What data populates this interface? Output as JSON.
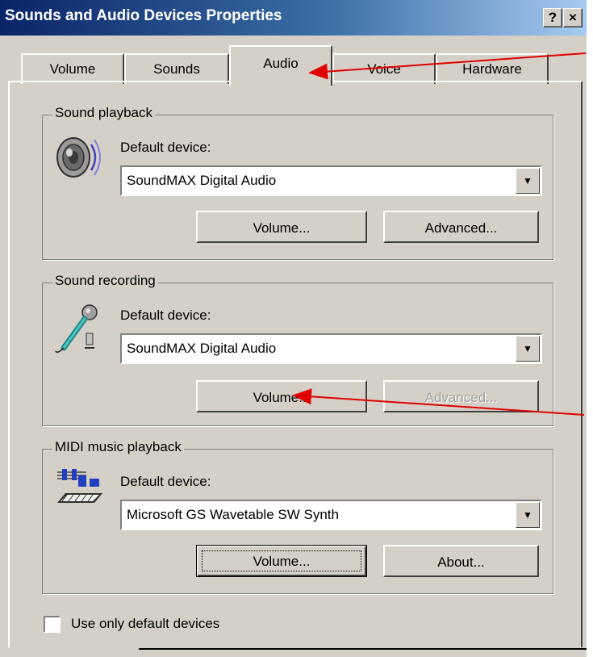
{
  "window": {
    "title": "Sounds and Audio Devices Properties",
    "help_btn": "?",
    "close_btn": "×"
  },
  "tabs": [
    {
      "label": "Volume",
      "selected": false
    },
    {
      "label": "Sounds",
      "selected": false
    },
    {
      "label": "Audio",
      "selected": true
    },
    {
      "label": "Voice",
      "selected": false
    },
    {
      "label": "Hardware",
      "selected": false
    }
  ],
  "playback": {
    "group_label": "Sound playback",
    "default_label": "Default device:",
    "device": "SoundMAX Digital Audio",
    "volume_label": "Volume...",
    "advanced_label": "Advanced..."
  },
  "recording": {
    "group_label": "Sound recording",
    "default_label": "Default device:",
    "device": "SoundMAX Digital Audio",
    "volume_label": "Volume...",
    "advanced_label": "Advanced...",
    "advanced_enabled": false
  },
  "midi": {
    "group_label": "MIDI music playback",
    "default_label": "Default device:",
    "device": "Microsoft GS Wavetable SW Synth",
    "volume_label": "Volume...",
    "about_label": "About..."
  },
  "checkbox": {
    "label": "Use only default devices",
    "checked": false
  },
  "colors": {
    "dialog_face": "#d4d0c8",
    "title_start": "#0a246a",
    "title_end": "#a6caf0",
    "annotation_arrow": "#e00000"
  },
  "icons": {
    "playback": "speaker-icon",
    "recording": "microphone-icon",
    "midi": "midi-keyboard-icon",
    "combo": "dropdown-arrow-icon"
  }
}
